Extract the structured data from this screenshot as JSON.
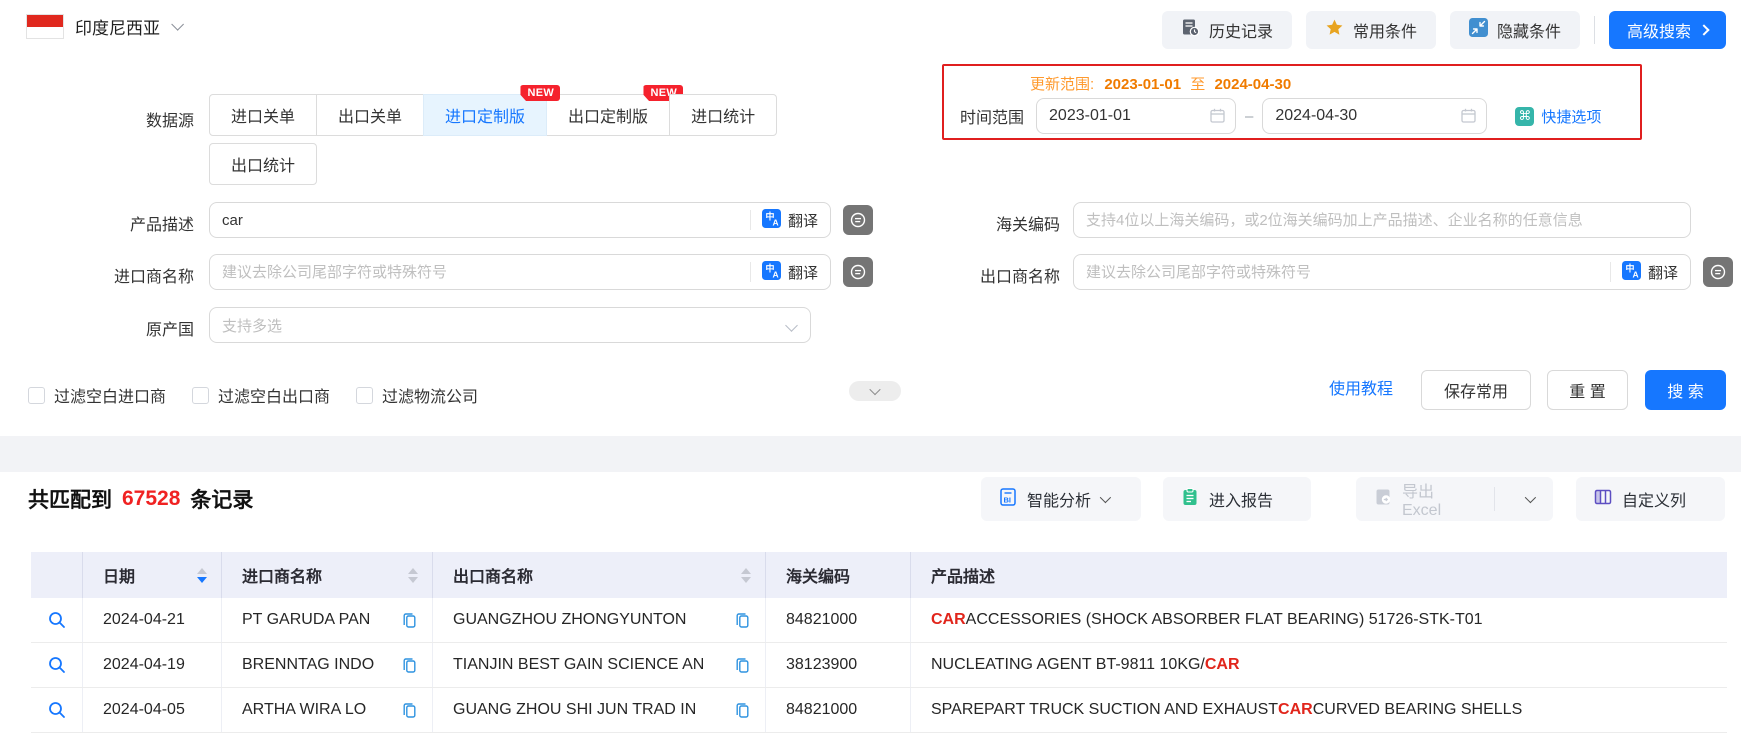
{
  "colors": {
    "primary": "#1677ff",
    "highlight_red": "#e1251b",
    "count_red": "#f02222",
    "badge_red": "#f5222d",
    "update_orange": "#f07b00",
    "quick_teal": "#35b5aa",
    "star_gold": "#e8a421",
    "report_green": "#30c08d",
    "columns_purple": "#5d4ec2",
    "table_header_bg": "#edeff9"
  },
  "topbar": {
    "country": "印度尼西亚",
    "history": "历史记录",
    "favorites": "常用条件",
    "hide_conditions": "隐藏条件",
    "advanced_search": "高级搜索"
  },
  "form": {
    "data_source_label": "数据源",
    "tabs": [
      {
        "label": "进口关单",
        "active": false,
        "badge": "",
        "row": 1
      },
      {
        "label": "出口关单",
        "active": false,
        "badge": "",
        "row": 1
      },
      {
        "label": "进口定制版",
        "active": true,
        "badge": "NEW",
        "row": 1
      },
      {
        "label": "出口定制版",
        "active": false,
        "badge": "NEW",
        "row": 1
      },
      {
        "label": "进口统计",
        "active": false,
        "badge": "",
        "row": 1
      },
      {
        "label": "出口统计",
        "active": false,
        "badge": "",
        "row": 2
      }
    ],
    "update_range": {
      "label": "更新范围:",
      "start": "2023-01-01",
      "separator": "至",
      "end": "2024-04-30"
    },
    "time_range": {
      "label": "时间范围",
      "start": "2023-01-01",
      "end": "2024-04-30",
      "quick_label": "快捷选项"
    },
    "fields": {
      "product": {
        "label": "产品描述",
        "value": "car",
        "translate": "翻译"
      },
      "hs_code": {
        "label": "海关编码",
        "placeholder": "支持4位以上海关编码，或2位海关编码加上产品描述、企业名称的任意信息"
      },
      "importer": {
        "label": "进口商名称",
        "placeholder": "建议去除公司尾部字符或特殊符号",
        "translate": "翻译"
      },
      "exporter": {
        "label": "出口商名称",
        "placeholder": "建议去除公司尾部字符或特殊符号",
        "translate": "翻译"
      },
      "origin": {
        "label": "原产国",
        "placeholder": "支持多选"
      }
    },
    "filters": [
      {
        "label": "过滤空白进口商",
        "checked": false
      },
      {
        "label": "过滤空白出口商",
        "checked": false
      },
      {
        "label": "过滤物流公司",
        "checked": false
      }
    ],
    "actions": {
      "tutorial": "使用教程",
      "save": "保存常用",
      "reset": "重 置",
      "search": "搜 索"
    }
  },
  "results": {
    "summary": {
      "prefix": "共匹配到",
      "count": "67528",
      "suffix": "条记录"
    },
    "toolbar": {
      "analysis": "智能分析",
      "report": "进入报告",
      "export": "导出Excel",
      "export_disabled": true,
      "custom_columns": "自定义列"
    },
    "table": {
      "columns": [
        {
          "label": "日期",
          "sortable": true,
          "sort": "desc"
        },
        {
          "label": "进口商名称",
          "sortable": true,
          "sort": null
        },
        {
          "label": "出口商名称",
          "sortable": true,
          "sort": null
        },
        {
          "label": "海关编码",
          "sortable": false,
          "sort": null
        },
        {
          "label": "产品描述",
          "sortable": false,
          "sort": null
        }
      ],
      "rows": [
        {
          "date": "2024-04-21",
          "importer": "PT GARUDA PAN",
          "exporter": "GUANGZHOU ZHONGYUNTON",
          "hs_code": "84821000",
          "description": [
            {
              "text": "CAR",
              "highlight": true
            },
            {
              "text": " ACCESSORIES (SHOCK ABSORBER FLAT BEARING) 51726-STK-T01",
              "highlight": false
            }
          ]
        },
        {
          "date": "2024-04-19",
          "importer": "BRENNTAG INDO",
          "exporter": "TIANJIN BEST GAIN SCIENCE AN",
          "hs_code": "38123900",
          "description": [
            {
              "text": "NUCLEATING AGENT BT-9811 10KG/",
              "highlight": false
            },
            {
              "text": "CAR",
              "highlight": true
            }
          ]
        },
        {
          "date": "2024-04-05",
          "importer": "ARTHA WIRA LO",
          "exporter": "GUANG ZHOU SHI JUN TRAD IN",
          "hs_code": "84821000",
          "description": [
            {
              "text": "SPAREPART TRUCK SUCTION AND EXHAUST ",
              "highlight": false
            },
            {
              "text": "CAR",
              "highlight": true
            },
            {
              "text": " CURVED BEARING SHELLS",
              "highlight": false
            }
          ]
        }
      ]
    }
  }
}
